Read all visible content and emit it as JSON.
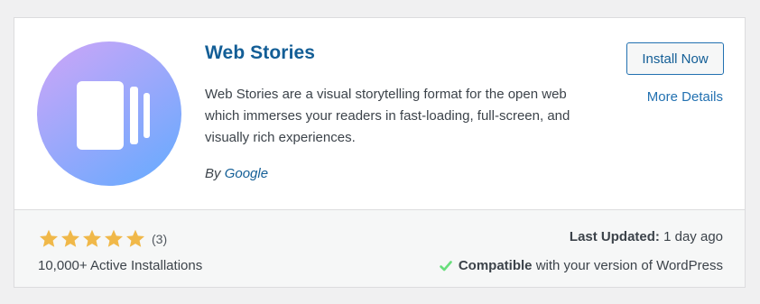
{
  "plugin": {
    "name": "Web Stories",
    "description": "Web Stories are a visual storytelling format for the open web which immerses your readers in fast-loading, full-screen, and visually rich experiences.",
    "author_prefix": "By",
    "author": "Google",
    "icon": "web-stories-logo-icon",
    "icon_gradient": [
      "#c8a6f8",
      "#6aaafe"
    ]
  },
  "actions": {
    "install_label": "Install Now",
    "more_details_label": "More Details"
  },
  "stats": {
    "rating_stars": 5,
    "rating_max": 5,
    "rating_count": "(3)",
    "active_installs": "10,000+ Active Installations",
    "last_updated_label": "Last Updated:",
    "last_updated_value": "1 day ago",
    "compat_label": "Compatible",
    "compat_text": "with your version of WordPress"
  },
  "colors": {
    "link": "#135e96",
    "star": "#f0b849",
    "check": "#68de7c"
  }
}
